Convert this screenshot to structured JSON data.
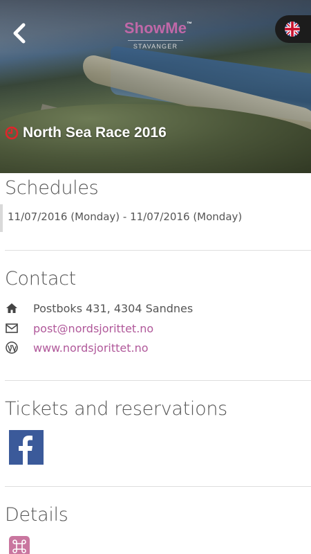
{
  "header": {
    "logo_name": "ShowMe",
    "logo_tm": "™",
    "logo_city": "STAVANGER",
    "language": "English (UK flag)"
  },
  "event": {
    "title": "North Sea Race 2016"
  },
  "schedules": {
    "title": "Schedules",
    "items": [
      "11/07/2016 (Monday) - 11/07/2016 (Monday)"
    ]
  },
  "contact": {
    "title": "Contact",
    "address": "Postboks 431, 4304 Sandnes",
    "email": "post@nordsjorittet.no",
    "website": "www.nordsjorittet.no"
  },
  "tickets": {
    "title": "Tickets and reservations",
    "facebook_icon": "facebook-icon"
  },
  "details": {
    "title": "Details",
    "icon": "command-key-icon"
  },
  "colors": {
    "brand": "#c068a8",
    "link": "#b0589a",
    "clock": "#e0252b",
    "facebook": "#3b5a9a",
    "details_icon_bg": "#c9769f"
  }
}
